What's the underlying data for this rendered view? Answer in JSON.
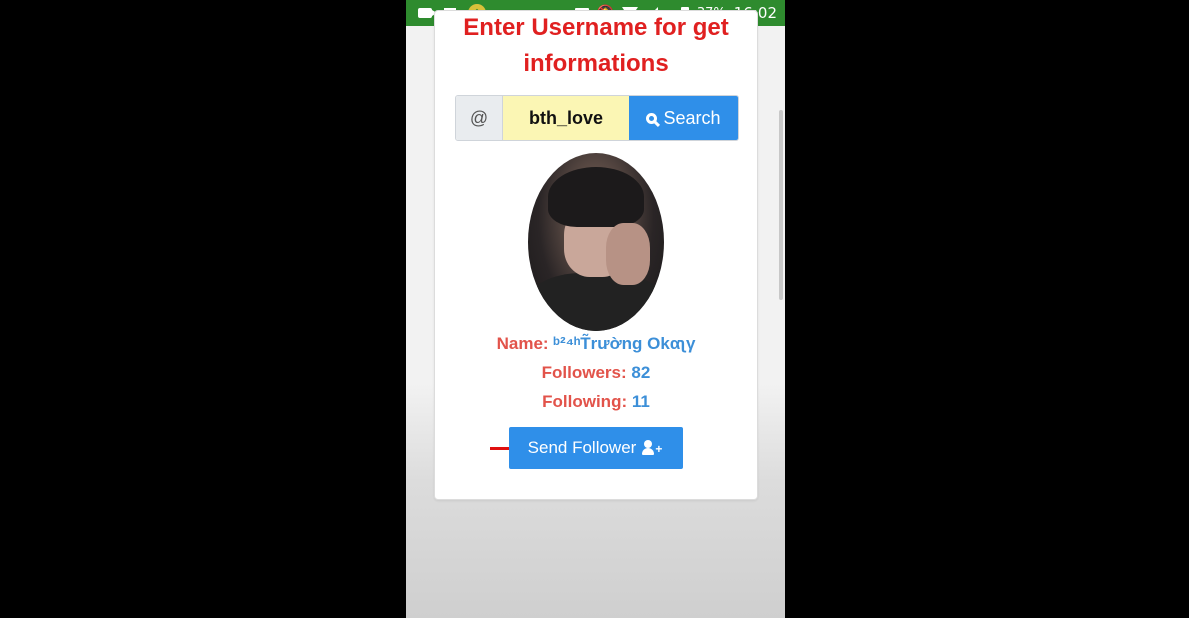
{
  "statusbar": {
    "app_badge": "⇧",
    "mute_glyph": "🔕",
    "network_letter": "H",
    "battery": "37%",
    "time": "16:02",
    "icons": [
      "video-icon",
      "image-icon",
      "app-icon",
      "cast-icon",
      "mute-icon",
      "wifi-icon",
      "signal-icon",
      "battery-icon"
    ]
  },
  "page": {
    "title_line1": "Enter Username for get",
    "title_line2": "informations"
  },
  "search": {
    "addon": "@",
    "value": "bth_love",
    "button_label": "Search"
  },
  "profile": {
    "name_label": "Name:",
    "name_value": "ᵇ²⁴ʰT̃rường Οkαʅγ",
    "followers_label": "Followers:",
    "followers_value": "82",
    "following_label": "Following:",
    "following_value": "11"
  },
  "actions": {
    "send_follower_label": "Send Follower"
  },
  "colors": {
    "statusbar": "#2e8b2e",
    "title": "#e02020",
    "label": "#e2534a",
    "value": "#3c8fd8",
    "button": "#2f8fe9",
    "input_bg": "#fbf6b4",
    "arrow": "#e01010"
  }
}
